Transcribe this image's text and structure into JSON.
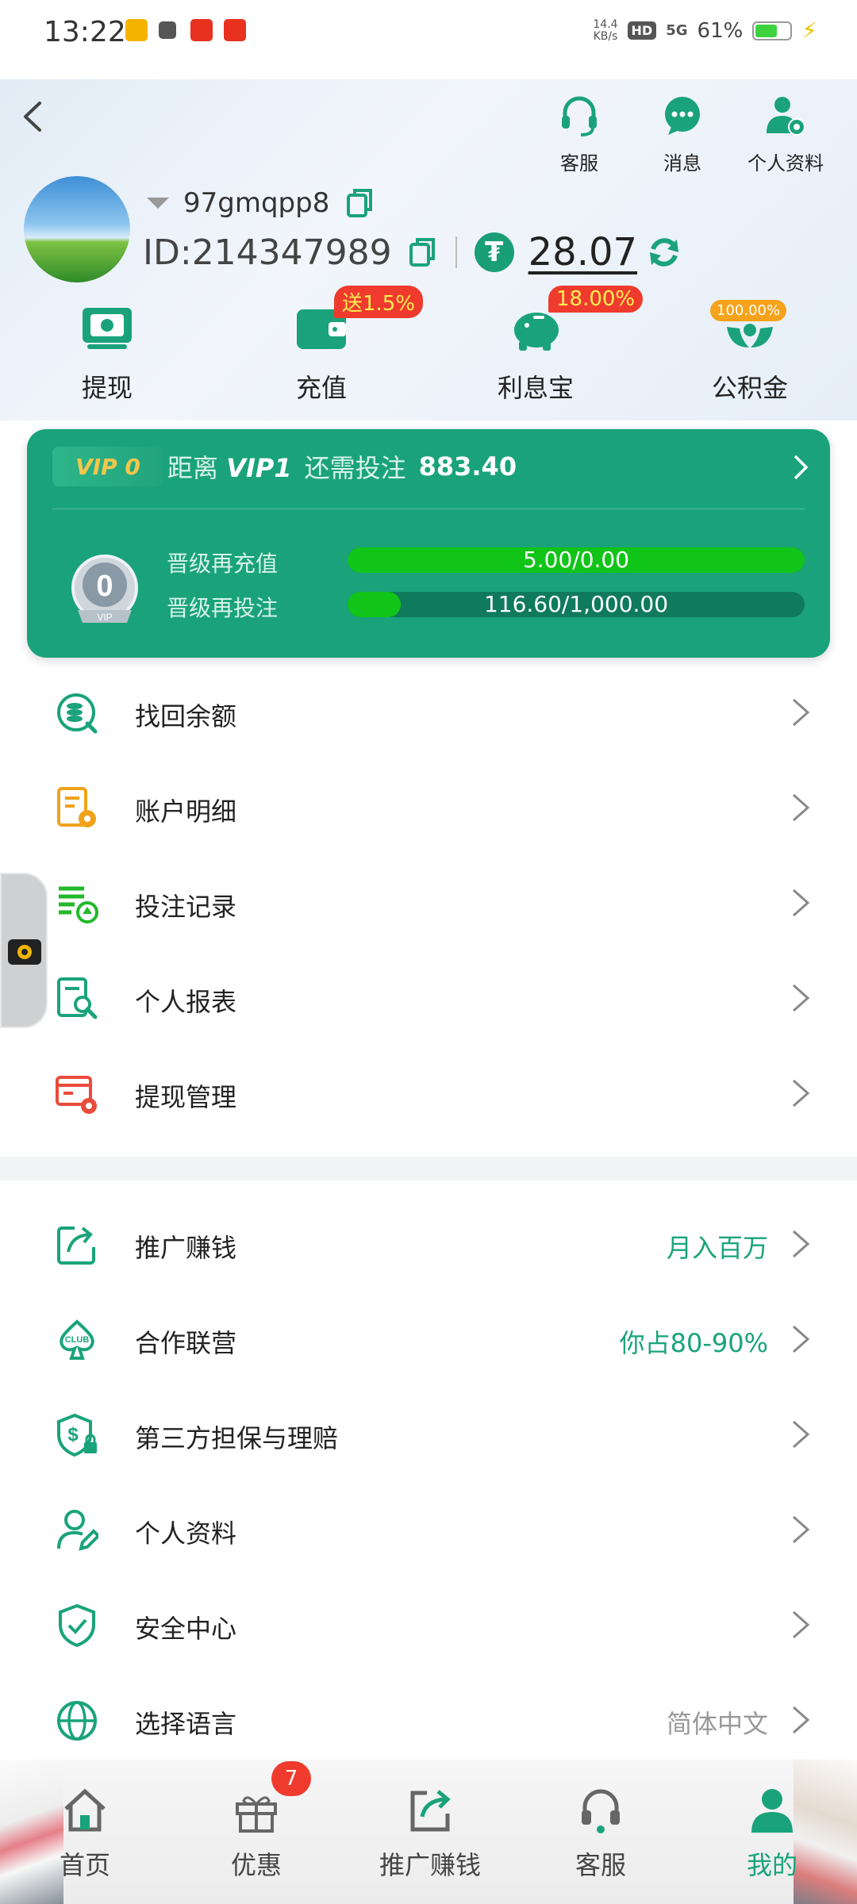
{
  "status_bar": {
    "time": "13:22",
    "speed_top": "14.4",
    "speed_unit": "KB/s",
    "hd": "HD",
    "network": "5G",
    "battery": "61%"
  },
  "header": {
    "actions": [
      {
        "label": "客服",
        "icon": "headset-icon"
      },
      {
        "label": "消息",
        "icon": "chat-bubble-icon"
      },
      {
        "label": "个人资料",
        "icon": "user-settings-icon"
      }
    ],
    "username": "97gmqpp8",
    "id_prefix": "ID:",
    "id_value": "214347989",
    "currency_symbol": "₮",
    "balance": "28.07"
  },
  "quick_actions": [
    {
      "label": "提现",
      "icon": "withdraw-cash-icon"
    },
    {
      "label": "充值",
      "icon": "wallet-icon",
      "badge": "送1.5%"
    },
    {
      "label": "利息宝",
      "icon": "piggy-bank-icon",
      "badge": "18.00%"
    },
    {
      "label": "公积金",
      "icon": "hands-fund-icon",
      "badge": "100.00%"
    }
  ],
  "vip": {
    "level_tag": "VIP 0",
    "distance_prefix": "距离",
    "target_level": "VIP1",
    "need_text": "还需投注",
    "need_amount": "883.40",
    "medal_number": "0",
    "medal_text": "VIP",
    "rows": [
      {
        "label": "晋级再充值",
        "value": "5.00/0.00",
        "progress": 1.0
      },
      {
        "label": "晋级再投注",
        "value": "116.60/1,000.00",
        "progress": 0.1166
      }
    ]
  },
  "menu_group1": [
    {
      "label": "找回余额",
      "icon": "coin-stack-search-icon"
    },
    {
      "label": "账户明细",
      "icon": "account-details-icon"
    },
    {
      "label": "投注记录",
      "icon": "bet-records-icon"
    },
    {
      "label": "个人报表",
      "icon": "report-search-icon"
    },
    {
      "label": "提现管理",
      "icon": "withdraw-settings-icon"
    }
  ],
  "menu_group2": [
    {
      "label": "推广赚钱",
      "extra": "月入百万",
      "icon": "share-icon"
    },
    {
      "label": "合作联营",
      "extra": "你占80-90%",
      "icon": "club-icon"
    },
    {
      "label": "第三方担保与理赔",
      "extra": "",
      "icon": "dollar-shield-icon"
    },
    {
      "label": "个人资料",
      "extra": "",
      "icon": "user-edit-icon"
    },
    {
      "label": "安全中心",
      "extra": "",
      "icon": "shield-check-icon"
    },
    {
      "label": "选择语言",
      "extra": "简体中文",
      "icon": "globe-icon"
    }
  ],
  "bottom_nav": [
    {
      "label": "首页",
      "icon": "home-icon"
    },
    {
      "label": "优惠",
      "icon": "gift-icon",
      "badge": "7"
    },
    {
      "label": "推广赚钱",
      "icon": "share-box-icon"
    },
    {
      "label": "客服",
      "icon": "headset-icon"
    },
    {
      "label": "我的",
      "icon": "person-icon"
    }
  ],
  "colors": {
    "brand": "#1aa37a",
    "progress": "#10c418",
    "badge_red": "#ef3b2d",
    "badge_orange": "#f6a21a",
    "vip_gold": "#f3c64a"
  }
}
